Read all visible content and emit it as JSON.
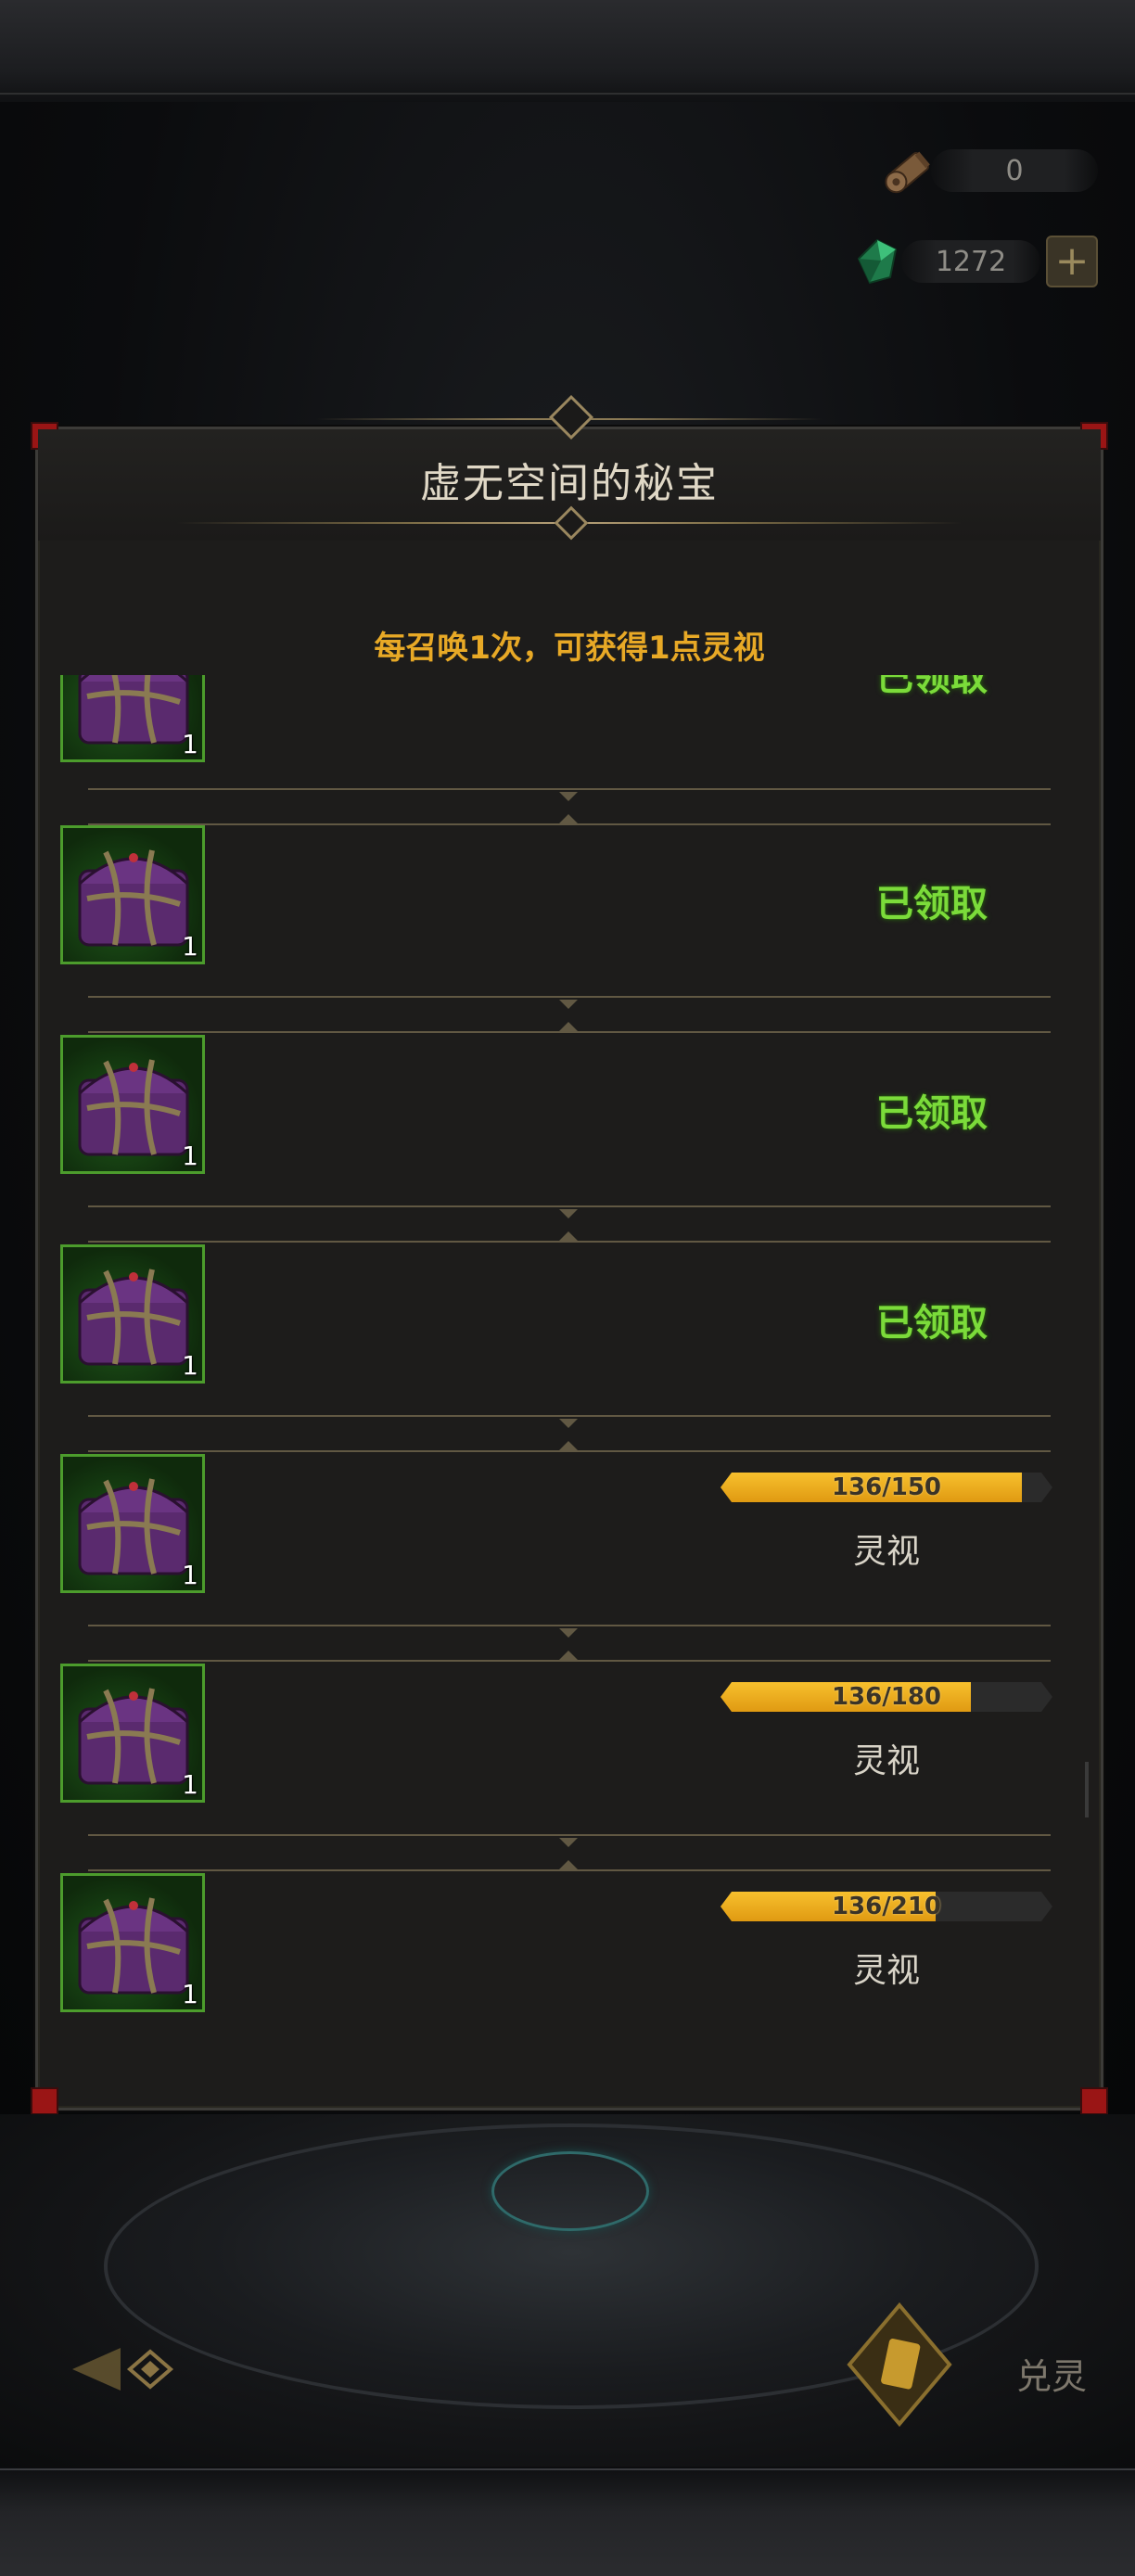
{
  "currencies": [
    {
      "icon": "scroll-icon",
      "value": "0"
    },
    {
      "icon": "green-gem-icon",
      "value": "1272",
      "has_add": true
    }
  ],
  "panel": {
    "title": "虚无空间的秘宝",
    "subtitle": "每召唤1次，可获得1点灵视"
  },
  "rewards": [
    {
      "count": "1",
      "status": "claimed",
      "status_text": "已领取"
    },
    {
      "count": "1",
      "status": "claimed",
      "status_text": "已领取"
    },
    {
      "count": "1",
      "status": "claimed",
      "status_text": "已领取"
    },
    {
      "count": "1",
      "status": "claimed",
      "status_text": "已领取"
    },
    {
      "count": "1",
      "status": "progress",
      "progress_text": "136/150",
      "current": 136,
      "target": 150,
      "label": "灵视"
    },
    {
      "count": "1",
      "status": "progress",
      "progress_text": "136/180",
      "current": 136,
      "target": 180,
      "label": "灵视"
    },
    {
      "count": "1",
      "status": "progress",
      "progress_text": "136/210",
      "current": 136,
      "target": 210,
      "label": "灵视"
    }
  ],
  "footer": {
    "convert_label": "兑灵"
  },
  "colors": {
    "accent_gold": "#e8a926",
    "claimed_green": "#7bdb3a",
    "progress_fill": "#f7c02d"
  }
}
